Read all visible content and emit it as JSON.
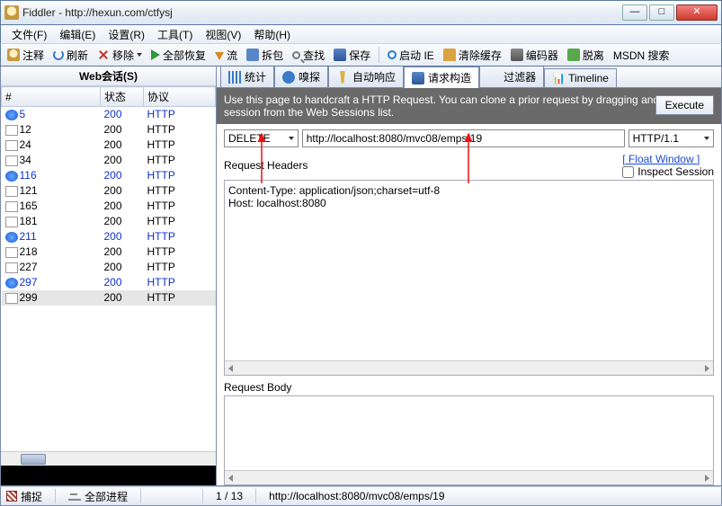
{
  "title": "Fiddler - http://hexun.com/ctfysj",
  "menu": [
    "文件(F)",
    "编辑(E)",
    "设置(R)",
    "工具(T)",
    "视图(V)",
    "帮助(H)"
  ],
  "toolbar": {
    "comment": "注释",
    "refresh": "刷新",
    "remove": "移除",
    "replay_all": "全部恢复",
    "stream": "流",
    "unhand": "拆包",
    "find": "查找",
    "save": "保存",
    "launch_ie": "启动 IE",
    "clear_cache": "清除缓存",
    "encoder": "编码器",
    "detach": "脱离",
    "msdn": "MSDN 搜索"
  },
  "sessions": {
    "title": "Web会话(S)",
    "cols": {
      "id": "#",
      "status": "状态",
      "proto": "协议"
    },
    "rows": [
      {
        "icon": "blue",
        "id": "5",
        "status": "200",
        "proto": "HTTP",
        "blue": true
      },
      {
        "icon": "doc",
        "id": "12",
        "status": "200",
        "proto": "HTTP"
      },
      {
        "icon": "doc",
        "id": "24",
        "status": "200",
        "proto": "HTTP"
      },
      {
        "icon": "doc",
        "id": "34",
        "status": "200",
        "proto": "HTTP"
      },
      {
        "icon": "blue",
        "id": "116",
        "status": "200",
        "proto": "HTTP",
        "blue": true
      },
      {
        "icon": "doc",
        "id": "121",
        "status": "200",
        "proto": "HTTP"
      },
      {
        "icon": "doc",
        "id": "165",
        "status": "200",
        "proto": "HTTP"
      },
      {
        "icon": "doc",
        "id": "181",
        "status": "200",
        "proto": "HTTP"
      },
      {
        "icon": "blue",
        "id": "211",
        "status": "200",
        "proto": "HTTP",
        "blue": true
      },
      {
        "icon": "doc",
        "id": "218",
        "status": "200",
        "proto": "HTTP"
      },
      {
        "icon": "doc",
        "id": "227",
        "status": "200",
        "proto": "HTTP"
      },
      {
        "icon": "blue",
        "id": "297",
        "status": "200",
        "proto": "HTTP",
        "blue": true
      },
      {
        "icon": "doc",
        "id": "299",
        "status": "200",
        "proto": "HTTP",
        "selected": true
      }
    ]
  },
  "tabs": {
    "stats": "统计",
    "sniff": "嗅探",
    "auto": "自动响应",
    "composer": "请求构造",
    "filter": "过滤器",
    "timeline": "Timeline"
  },
  "composer": {
    "hint": "Use this page to handcraft a HTTP Request.  You can clone a prior request by dragging and dropping a session from the Web Sessions list.",
    "execute": "Execute",
    "method": "DELETE",
    "url": "http://localhost:8080/mvc08/emps/19",
    "httpver": "HTTP/1.1",
    "req_headers_label": "Request Headers",
    "float_window": "[ Float Window ]",
    "inspect_label": "Inspect Session",
    "headers_line1": "Content-Type: application/json;charset=utf-8",
    "headers_line2": "Host: localhost:8080",
    "req_body_label": "Request Body"
  },
  "status": {
    "capture": "捕捉",
    "allproc": "全部进程",
    "count": "1 / 13",
    "url": "http://localhost:8080/mvc08/emps/19"
  }
}
